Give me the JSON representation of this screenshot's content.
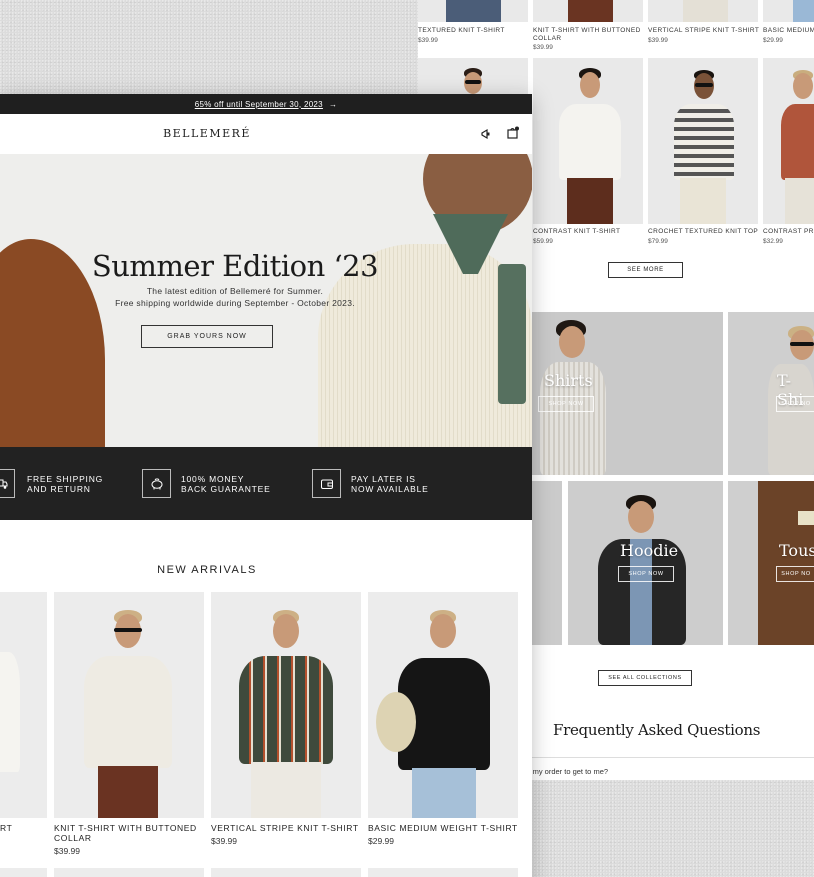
{
  "back_panel": {
    "top_products": [
      {
        "name": "TEXTURED KNIT T-SHIRT",
        "price": "$39.99"
      },
      {
        "name": "KNIT T-SHIRT WITH BUTTONED COLLAR",
        "price": "$39.99"
      },
      {
        "name": "VERTICAL STRIPE KNIT T-SHIRT",
        "price": "$39.99"
      },
      {
        "name": "BASIC MEDIUM",
        "price": "$29.99"
      }
    ],
    "second_products": [
      {
        "name": "CONTRAST KNIT T-SHIRT",
        "price": "$59.99"
      },
      {
        "name": "CROCHET TEXTURED KNIT TOP",
        "price": "$79.99"
      },
      {
        "name": "CONTRAST PRI",
        "price": "$32.99"
      }
    ],
    "see_more_label": "SEE MORE",
    "collections": [
      {
        "title": "Shirts",
        "cta": "SHOP NOW"
      },
      {
        "title": "T-Shi",
        "cta": "SHOP NO"
      },
      {
        "title": "Hoodie",
        "cta": "SHOP NOW"
      },
      {
        "title": "Touse",
        "cta": "SHOP NO"
      }
    ],
    "see_all_label": "SEE ALL COLLECTIONS",
    "faq_title": "Frequently Asked Questions",
    "faq_question": "r my order to get to me?"
  },
  "front_panel": {
    "announcement": "65% off until September 30, 2023",
    "announcement_arrow": "→",
    "brand": "BELLEMERÉ",
    "hero": {
      "title": "Summer Edition ‘23",
      "line1": "The latest edition of Bellemeré for Summer.",
      "line2": "Free shipping worldwide during September - October 2023.",
      "cta": "GRAB YOURS NOW"
    },
    "features": [
      {
        "line1": "FREE SHIPPING",
        "line2": "AND RETURN",
        "icon": "truck-icon"
      },
      {
        "line1": "100% MONEY",
        "line2": "BACK GUARANTEE",
        "icon": "piggy-bank-icon"
      },
      {
        "line1": "PAY LATER IS",
        "line2": "NOW AVAILABLE",
        "icon": "wallet-icon"
      }
    ],
    "new_arrivals_title": "NEW ARRIVALS",
    "products": [
      {
        "name": "RT",
        "price": ""
      },
      {
        "name": "KNIT T-SHIRT WITH BUTTONED COLLAR",
        "price": "$39.99"
      },
      {
        "name": "VERTICAL STRIPE KNIT T-SHIRT",
        "price": "$39.99"
      },
      {
        "name": "BASIC MEDIUM WEIGHT T-SHIRT",
        "price": "$29.99"
      }
    ]
  },
  "colors": {
    "dark": "#1f1f1f",
    "hero_bg": "#eeeeec",
    "accent_rust": "#8a4a24"
  }
}
